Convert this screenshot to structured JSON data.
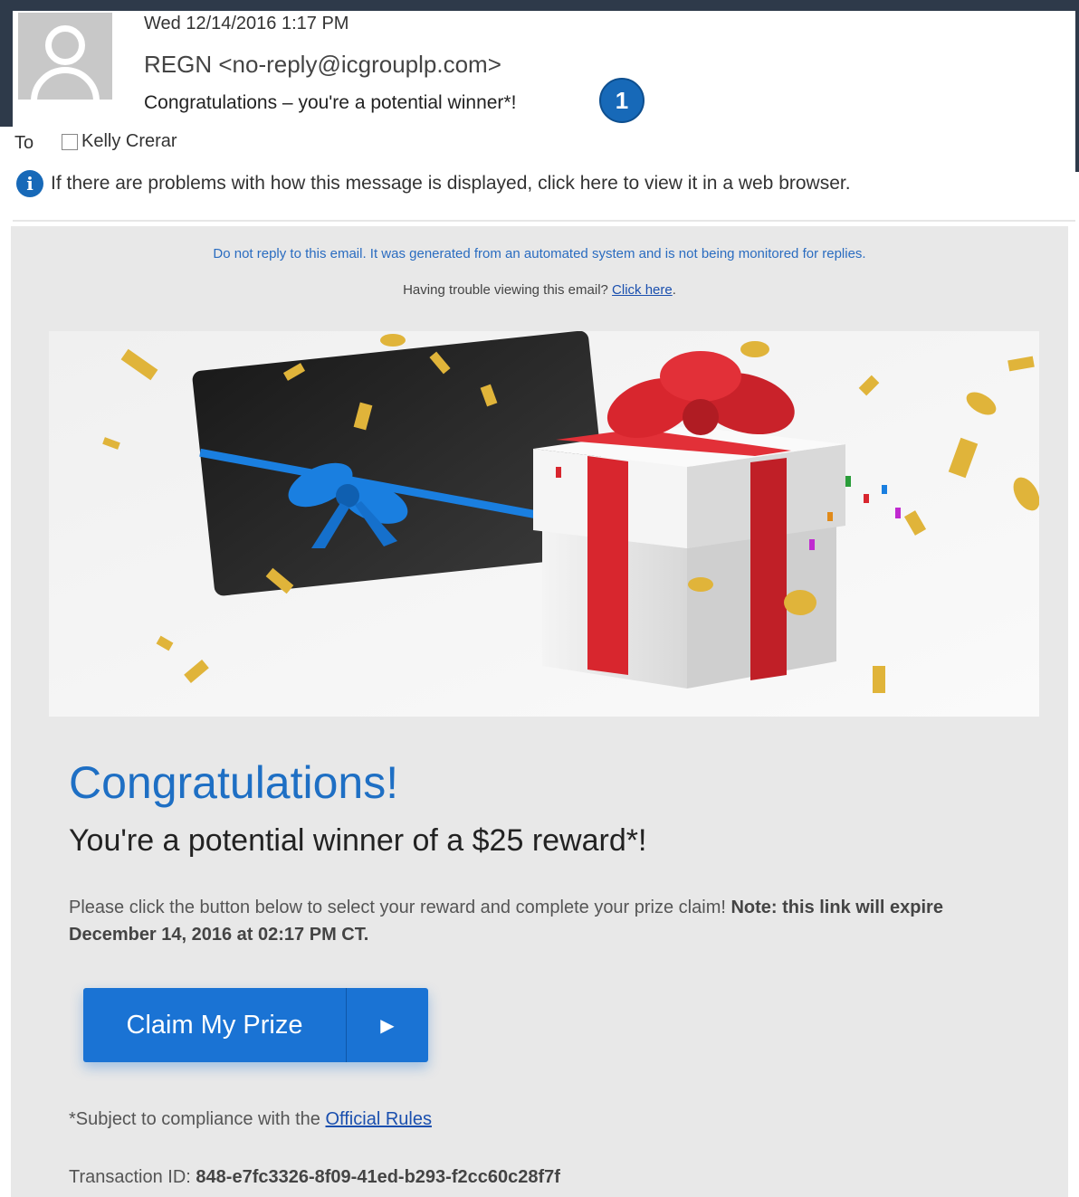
{
  "header": {
    "date": "Wed 12/14/2016 1:17 PM",
    "from": "REGN <no-reply@icgrouplp.com>",
    "subject": "Congratulations – you're a potential winner*!",
    "badge": "1",
    "to_label": "To",
    "recipient": "Kelly Crerar"
  },
  "infobar": {
    "icon": "info-icon",
    "text": "If there are problems with how this message is displayed, click here to view it in a web browser."
  },
  "body": {
    "noreply": "Do not reply to this email. It was generated from an automated system and is not being monitored for replies.",
    "trouble_text": "Having trouble viewing this email? ",
    "trouble_link": "Click here",
    "trouble_end": ".",
    "title": "Congratulations!",
    "subtitle": "You're a potential winner of a $25 reward*!",
    "instructions": "Please click the button below to select your reward and complete your prize claim! ",
    "instructions_bold": "Note: this link will expire December 14, 2016 at 02:17 PM CT.",
    "button_label": "Claim My Prize",
    "button_arrow": "▶",
    "rules_text": "*Subject to compliance with the ",
    "rules_link": "Official Rules",
    "txn_label": "Transaction ID: ",
    "txn_id": "848-e7fc3326-8f09-41ed-b293-f2cc60c28f7f"
  },
  "colors": {
    "accent": "#1a73d4",
    "title": "#1e6fc4",
    "ribbon_red": "#d8262e",
    "ribbon_blue": "#1a7fe0",
    "gold": "#e0b43a"
  }
}
